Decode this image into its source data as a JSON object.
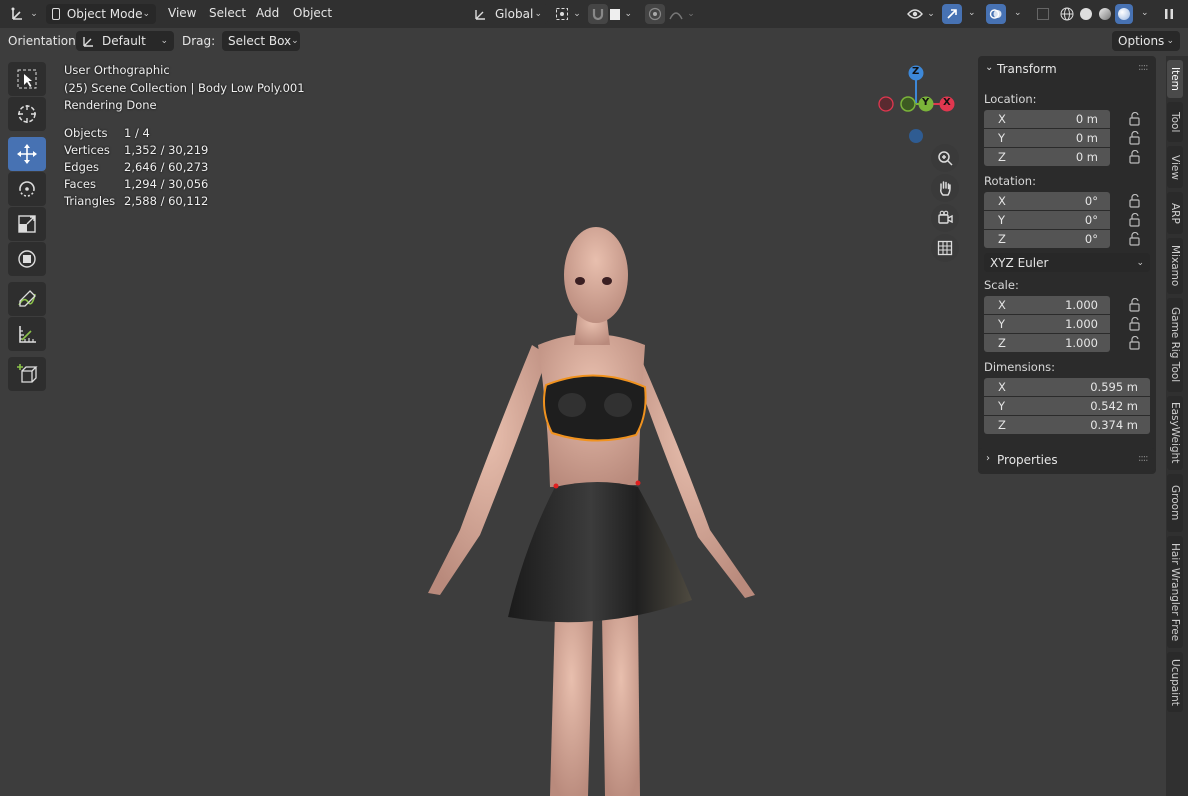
{
  "header": {
    "mode_label": "Object Mode",
    "menus": [
      "View",
      "Select",
      "Add",
      "Object"
    ],
    "transform_orientation": "Global"
  },
  "tool_header": {
    "orientation_label": "Orientation:",
    "orientation_value": "Default",
    "drag_label": "Drag:",
    "drag_value": "Select Box",
    "options_label": "Options"
  },
  "viewport": {
    "view_name": "User Orthographic",
    "collection": "(25) Scene Collection | Body Low Poly.001",
    "status": "Rendering Done",
    "stats": [
      {
        "label": "Objects",
        "value": "1 / 4"
      },
      {
        "label": "Vertices",
        "value": "1,352 / 30,219"
      },
      {
        "label": "Edges",
        "value": "2,646 / 60,273"
      },
      {
        "label": "Faces",
        "value": "1,294 / 30,056"
      },
      {
        "label": "Triangles",
        "value": "2,588 / 60,112"
      }
    ],
    "gizmo": {
      "z": "Z",
      "x": "X",
      "y": "Y"
    }
  },
  "transform_panel": {
    "title": "Transform",
    "location_label": "Location:",
    "location": [
      {
        "axis": "X",
        "value": "0 m"
      },
      {
        "axis": "Y",
        "value": "0 m"
      },
      {
        "axis": "Z",
        "value": "0 m"
      }
    ],
    "rotation_label": "Rotation:",
    "rotation": [
      {
        "axis": "X",
        "value": "0°"
      },
      {
        "axis": "Y",
        "value": "0°"
      },
      {
        "axis": "Z",
        "value": "0°"
      }
    ],
    "rotation_mode": "XYZ Euler",
    "scale_label": "Scale:",
    "scale": [
      {
        "axis": "X",
        "value": "1.000"
      },
      {
        "axis": "Y",
        "value": "1.000"
      },
      {
        "axis": "Z",
        "value": "1.000"
      }
    ],
    "dimensions_label": "Dimensions:",
    "dimensions": [
      {
        "axis": "X",
        "value": "0.595 m"
      },
      {
        "axis": "Y",
        "value": "0.542 m"
      },
      {
        "axis": "Z",
        "value": "0.374 m"
      }
    ],
    "properties_title": "Properties"
  },
  "sidebar_tabs": [
    "Item",
    "Tool",
    "View",
    "ARP",
    "Mixamo",
    "Game Rig Tool",
    "EasyWeight",
    "Groom",
    "Hair Wrangler Free",
    "Ucupaint"
  ],
  "colors": {
    "accent": "#4772b3",
    "selection_outline": "#f0921e",
    "axis_x": "#e0374f",
    "axis_y": "#7bb43a",
    "axis_z": "#3d88d8"
  }
}
